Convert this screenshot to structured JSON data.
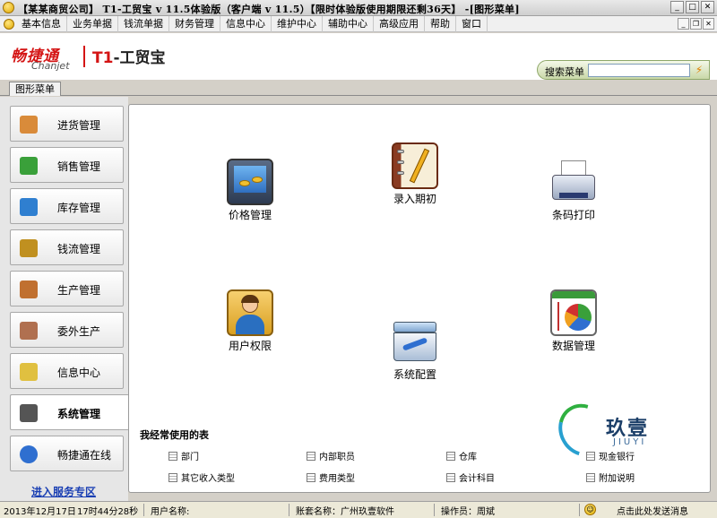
{
  "window": {
    "title": "【某某商贸公司】 T1-工贸宝 v 11.5体验版（客户端 v 11.5）【限时体验版使用期限还剩36天】 -[图形菜单]",
    "buttons": [
      "minimize",
      "maximize",
      "close"
    ]
  },
  "menubar": {
    "items": [
      "基本信息",
      "业务单据",
      "钱流单据",
      "财务管理",
      "信息中心",
      "维护中心",
      "辅助中心",
      "高级应用",
      "帮助",
      "窗口"
    ]
  },
  "header": {
    "logo_cn": "畅捷通",
    "logo_en": "Chanjet",
    "product_prefix": "T1",
    "product_suffix": "-工贸宝",
    "search_label": "搜索菜单",
    "search_value": "",
    "brand_color": "#d41414"
  },
  "tab": {
    "label": "图形菜单"
  },
  "sidebar": {
    "items": [
      {
        "label": "进货管理",
        "icon": "purchase-icon",
        "color": "#d98b3a"
      },
      {
        "label": "销售管理",
        "icon": "basket-icon",
        "color": "#3aa03a"
      },
      {
        "label": "库存管理",
        "icon": "inventory-icon",
        "color": "#2f7fd0"
      },
      {
        "label": "钱流管理",
        "icon": "money-icon",
        "color": "#c09020"
      },
      {
        "label": "生产管理",
        "icon": "production-icon",
        "color": "#c07030"
      },
      {
        "label": "委外生产",
        "icon": "outsource-icon",
        "color": "#b07050"
      },
      {
        "label": "信息中心",
        "icon": "info-icon",
        "color": "#e0c040"
      },
      {
        "label": "系统管理",
        "icon": "settings-icon",
        "color": "#555555",
        "active": true
      },
      {
        "label": "畅捷通在线",
        "icon": "globe-icon",
        "color": "#2f6fd0"
      }
    ],
    "service_link": "进入服务专区"
  },
  "features": [
    {
      "label": "价格管理",
      "icon": "price-monitor-icon"
    },
    {
      "label": "录入期初",
      "icon": "notebook-pencil-icon"
    },
    {
      "label": "条码打印",
      "icon": "printer-icon"
    },
    {
      "label": "用户权限",
      "icon": "user-icon"
    },
    {
      "label": "系统配置",
      "icon": "toolbox-icon"
    },
    {
      "label": "数据管理",
      "icon": "pie-chart-icon"
    }
  ],
  "favorites": {
    "title": "我经常使用的表",
    "items": [
      "部门",
      "内部职员",
      "仓库",
      "现金银行",
      "其它收入类型",
      "费用类型",
      "会计科目",
      "附加说明"
    ]
  },
  "watermark": {
    "cn": "玖壹",
    "en": "JIUYI"
  },
  "statusbar": {
    "date": "2013年12月17日",
    "time": "17时44分28秒",
    "user_label": "用户名称:",
    "account": "账套名称：广州玖壹软件",
    "operator": "操作员：周斌",
    "message": "点击此处发送消息"
  }
}
